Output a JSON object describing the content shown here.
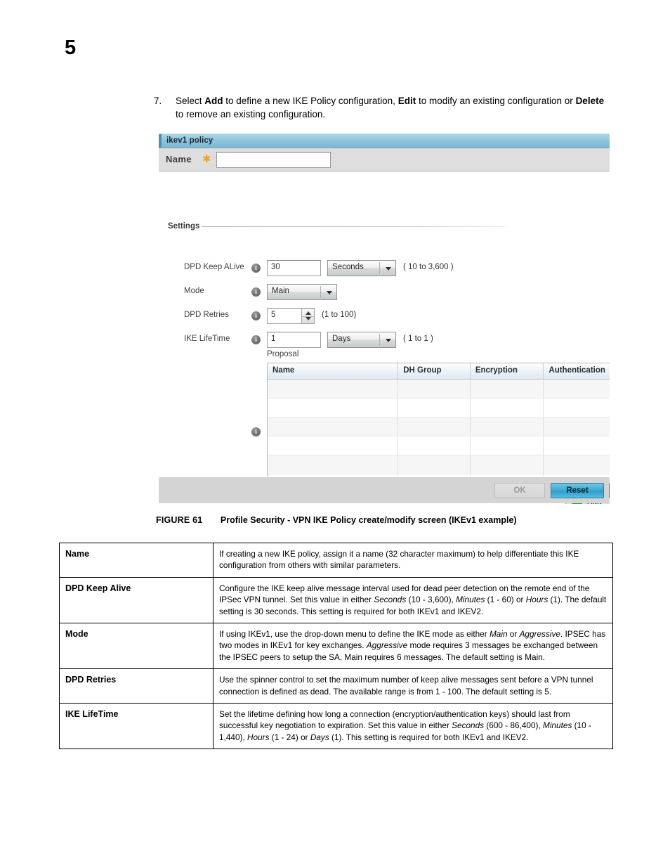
{
  "page": {
    "number": "5"
  },
  "step": {
    "number": "7.",
    "text_parts": [
      {
        "t": "Select ",
        "b": false
      },
      {
        "t": "Add",
        "b": true
      },
      {
        "t": " to define a new IKE Policy configuration, ",
        "b": false
      },
      {
        "t": "Edit",
        "b": true
      },
      {
        "t": " to modify an existing configuration or ",
        "b": false
      },
      {
        "t": "Delete",
        "b": true
      },
      {
        "t": " to remove an existing configuration.",
        "b": false
      }
    ]
  },
  "dialog": {
    "title": "ikev1 policy",
    "name_field": {
      "label": "Name",
      "required_marker": "✱",
      "value": "",
      "placeholder": ""
    },
    "section": {
      "heading": "Settings"
    },
    "fields": [
      {
        "label": "DPD Keep ALive",
        "info_icon": "info-icon",
        "value": "30",
        "unit": "Seconds",
        "range_hint": "( 10 to 3,600 )"
      },
      {
        "label": "Mode",
        "info_icon": "info-icon",
        "value": "Main",
        "unit": "",
        "range_hint": ""
      },
      {
        "label": "DPD Retries",
        "info_icon": "info-icon",
        "value": "5",
        "unit": "",
        "range_hint": "(1 to 100)"
      },
      {
        "label": "IKE LifeTime",
        "info_icon": "info-icon",
        "value": "1",
        "unit": "Days",
        "range_hint": "( 1 to 1 )"
      }
    ],
    "proposal": {
      "label": "Proposal",
      "info_icon": "info-icon",
      "columns": [
        "Name",
        "DH Group",
        "Encryption",
        "Authentication"
      ],
      "rows": [],
      "empty_row_count": 6,
      "add_button": {
        "label": "Add",
        "icon": "plus-icon"
      }
    },
    "footer_buttons": [
      {
        "label": "OK",
        "state": "disabled"
      },
      {
        "label": "Reset",
        "state": "enabled"
      },
      {
        "label": "",
        "state": "enabled"
      }
    ]
  },
  "figure": {
    "number": "FIGURE 61",
    "caption": "Profile Security - VPN IKE Policy create/modify screen (IKEv1 example)"
  },
  "description_table": {
    "rows": [
      {
        "key": "Name",
        "value": "If creating a new IKE policy, assign it a name (32 character maximum) to help differentiate this IKE configuration from others with similar parameters."
      },
      {
        "key": "DPD Keep Alive",
        "value_parts": [
          {
            "t": "Configure the IKE keep alive message interval used for dead peer detection on the remote end of the IPSec VPN tunnel. Set this value in either ",
            "i": false
          },
          {
            "t": "Seconds",
            "i": true
          },
          {
            "t": " (10 - 3,600), ",
            "i": false
          },
          {
            "t": "Minutes",
            "i": true
          },
          {
            "t": " (1 - 60) or ",
            "i": false
          },
          {
            "t": "Hours",
            "i": true
          },
          {
            "t": " (1). The default setting is 30 seconds. This setting is required for both IKEv1 and IKEV2.",
            "i": false
          }
        ]
      },
      {
        "key": "Mode",
        "value_parts": [
          {
            "t": "If using IKEv1, use the drop-down menu to define the IKE mode as either ",
            "i": false
          },
          {
            "t": "Main",
            "i": true
          },
          {
            "t": " or ",
            "i": false
          },
          {
            "t": "Aggressive",
            "i": true
          },
          {
            "t": ". IPSEC has two modes in IKEv1 for key exchanges. ",
            "i": false
          },
          {
            "t": "Aggressive",
            "i": true
          },
          {
            "t": " mode requires 3 messages be exchanged between the IPSEC peers to setup the SA, Main requires 6 messages. The default setting is Main.",
            "i": false
          }
        ]
      },
      {
        "key": "DPD Retries",
        "value": "Use the spinner control to set the maximum number of keep alive messages sent before a VPN tunnel connection is defined as dead. The available range is from 1 - 100. The default setting is 5."
      },
      {
        "key": "IKE LifeTime",
        "value_parts": [
          {
            "t": "Set the lifetime defining how long a connection (encryption/authentication keys) should last from successful key negotiation to expiration. Set this value in either ",
            "i": false
          },
          {
            "t": "Seconds",
            "i": true
          },
          {
            "t": " (600 - 86,400), ",
            "i": false
          },
          {
            "t": "Minutes",
            "i": true
          },
          {
            "t": " (10 - 1,440), ",
            "i": false
          },
          {
            "t": "Hours",
            "i": true
          },
          {
            "t": " (1 - 24) or ",
            "i": false
          },
          {
            "t": "Days",
            "i": true
          },
          {
            "t": " (1). This setting is required for both IKEv1 and IKEV2.",
            "i": false
          }
        ]
      }
    ]
  },
  "colors": {
    "title_bar": "#8cc3db",
    "required_star": "#f0a030",
    "primary_button": "#3fa9d4",
    "add_plus": "#2aa62a"
  }
}
